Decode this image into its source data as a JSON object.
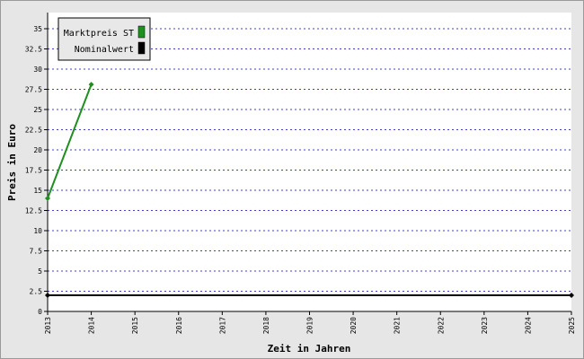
{
  "chart_data": {
    "type": "line",
    "title": "",
    "xlabel": "Zeit in Jahren",
    "ylabel": "Preis in Euro",
    "xlim": [
      2013,
      2025
    ],
    "ylim": [
      0,
      37
    ],
    "x_ticks": [
      "2013",
      "2014",
      "2015",
      "2016",
      "2017",
      "2018",
      "2019",
      "2020",
      "2021",
      "2022",
      "2023",
      "2024",
      "2025"
    ],
    "y_ticks": [
      "0",
      "2.5",
      "5",
      "7.5",
      "10",
      "12.5",
      "15",
      "17.5",
      "20",
      "22.5",
      "25",
      "27.5",
      "30",
      "32.5",
      "35"
    ],
    "grid": true,
    "legend_position": "top-left",
    "series": [
      {
        "name": "Marktpreis ST",
        "color": "#1f8f1f",
        "x": [
          2013,
          2014
        ],
        "y": [
          14.0,
          28.1
        ]
      },
      {
        "name": "Nominalwert",
        "color": "#000000",
        "x": [
          2013,
          2025
        ],
        "y": [
          2.0,
          2.0
        ]
      }
    ]
  }
}
